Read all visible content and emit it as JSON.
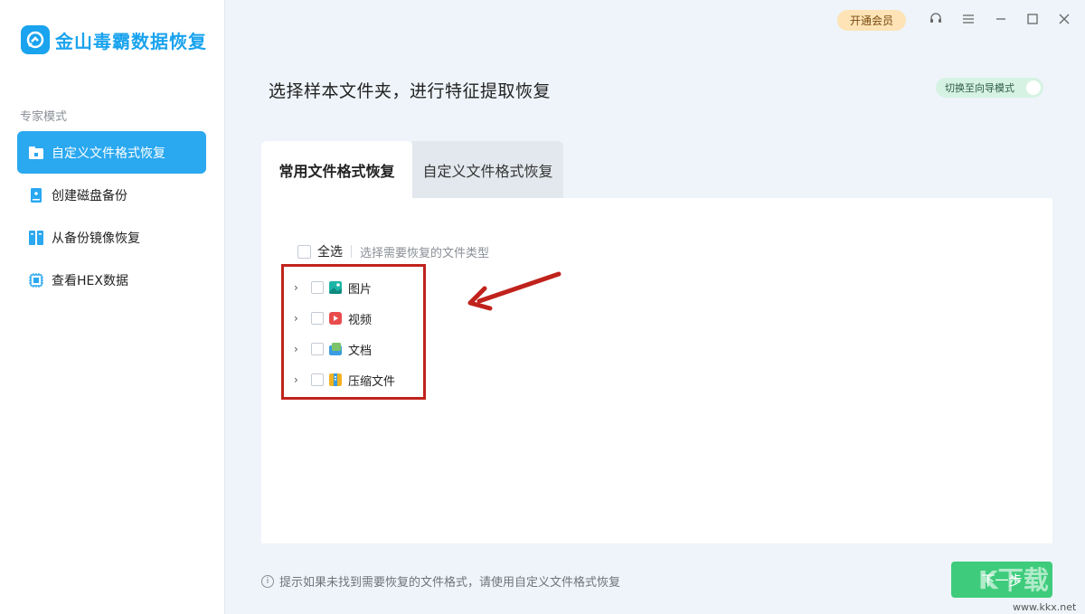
{
  "app": {
    "name": "金山毒霸数据恢复",
    "brand_color": "#1aa3ee"
  },
  "sidebar": {
    "section_label": "专家模式",
    "items": [
      {
        "label": "自定义文件格式恢复",
        "icon": "folder-icon",
        "active": true
      },
      {
        "label": "创建磁盘备份",
        "icon": "disk-backup-icon",
        "active": false
      },
      {
        "label": "从备份镜像恢复",
        "icon": "image-restore-icon",
        "active": false
      },
      {
        "label": "查看HEX数据",
        "icon": "hex-chip-icon",
        "active": false
      }
    ]
  },
  "topbar": {
    "vip_label": "开通会员"
  },
  "header": {
    "title": "选择样本文件夹，进行特征提取恢复",
    "mode_switch_label": "切换至向导模式"
  },
  "tabs": [
    {
      "label": "常用文件格式恢复",
      "active": true
    },
    {
      "label": "自定义文件格式恢复",
      "active": false
    }
  ],
  "panel": {
    "select_all_label": "全选",
    "select_hint": "选择需要恢复的文件类型",
    "file_types": [
      {
        "label": "图片",
        "icon": "image-icon",
        "color": "#1cb5a7"
      },
      {
        "label": "视频",
        "icon": "video-icon",
        "color": "#e84c4c"
      },
      {
        "label": "文档",
        "icon": "document-icon",
        "color": "#3a9de0"
      },
      {
        "label": "压缩文件",
        "icon": "archive-icon",
        "color": "#f0b323"
      }
    ]
  },
  "footer": {
    "tip": "提示如果未找到需要恢复的文件格式，请使用自定义文件格式恢复",
    "next_label": "下一步"
  },
  "watermark": {
    "text": "K下载",
    "url": "www.kkx.net"
  }
}
